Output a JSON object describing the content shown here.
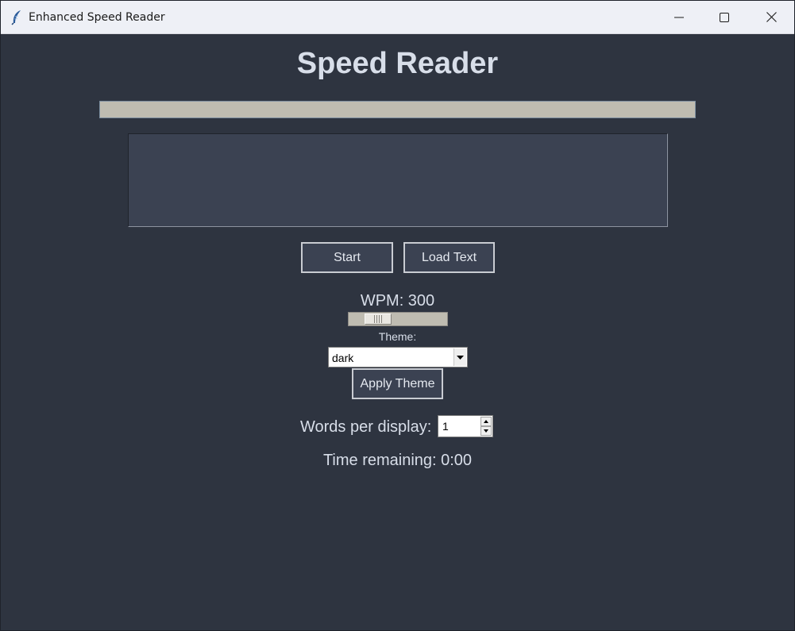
{
  "window": {
    "title": "Enhanced Speed Reader",
    "icon": "feather-icon",
    "controls": [
      "minimize-icon",
      "maximize-icon",
      "close-icon"
    ]
  },
  "app": {
    "heading": "Speed Reader",
    "progress_value": 0,
    "word_display": "",
    "buttons": {
      "start_label": "Start",
      "load_label": "Load Text",
      "apply_theme_label": "Apply Theme"
    },
    "wpm": {
      "label": "WPM: 300",
      "value": 300
    },
    "theme": {
      "label": "Theme:",
      "selected": "dark"
    },
    "words_per_display": {
      "label": "Words per display:",
      "value": "1"
    },
    "time_remaining": "Time remaining: 0:00"
  },
  "colors": {
    "background": "#2e3440",
    "panel": "#3b4252",
    "text": "#d8dee9",
    "titlebar": "#eef0f6"
  }
}
